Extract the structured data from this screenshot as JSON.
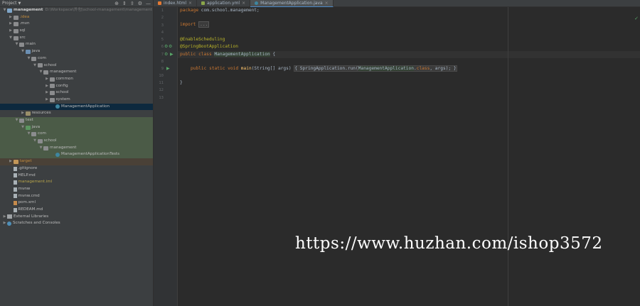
{
  "project_panel": {
    "title": "Project",
    "tree": [
      {
        "label": "management",
        "suffix": "D:\\Workspace\\外包\\school-management\\management",
        "bold": true,
        "depth": 0,
        "arrow": "down",
        "icon": "module"
      },
      {
        "label": ".idea",
        "depth": 1,
        "arrow": "right",
        "icon": "folder",
        "style": "orange"
      },
      {
        "label": ".mvn",
        "depth": 1,
        "arrow": "right",
        "icon": "folder"
      },
      {
        "label": "sql",
        "depth": 1,
        "arrow": "right",
        "icon": "folder"
      },
      {
        "label": "src",
        "depth": 1,
        "arrow": "down",
        "icon": "folder"
      },
      {
        "label": "main",
        "depth": 2,
        "arrow": "down",
        "icon": "folder"
      },
      {
        "label": "java",
        "depth": 3,
        "arrow": "down",
        "icon": "folder-blue"
      },
      {
        "label": "com",
        "depth": 4,
        "arrow": "down",
        "icon": "pkg"
      },
      {
        "label": "school",
        "depth": 5,
        "arrow": "down",
        "icon": "pkg"
      },
      {
        "label": "management",
        "depth": 6,
        "arrow": "down",
        "icon": "pkg"
      },
      {
        "label": "common",
        "depth": 7,
        "arrow": "right",
        "icon": "pkg"
      },
      {
        "label": "config",
        "depth": 7,
        "arrow": "right",
        "icon": "pkg"
      },
      {
        "label": "school",
        "depth": 7,
        "arrow": "right",
        "icon": "pkg"
      },
      {
        "label": "system",
        "depth": 7,
        "arrow": "right",
        "icon": "pkg"
      },
      {
        "label": "ManagementApplication",
        "depth": 8,
        "arrow": "",
        "icon": "class",
        "row": "sel"
      },
      {
        "label": "resources",
        "depth": 3,
        "arrow": "right",
        "icon": "folder-res"
      },
      {
        "label": "test",
        "depth": 2,
        "arrow": "down",
        "icon": "folder",
        "row": "band"
      },
      {
        "label": "java",
        "depth": 3,
        "arrow": "down",
        "icon": "folder-green",
        "row": "band"
      },
      {
        "label": "com",
        "depth": 4,
        "arrow": "down",
        "icon": "pkg",
        "row": "band"
      },
      {
        "label": "school",
        "depth": 5,
        "arrow": "down",
        "icon": "pkg",
        "row": "band"
      },
      {
        "label": "management",
        "depth": 6,
        "arrow": "down",
        "icon": "pkg",
        "row": "band"
      },
      {
        "label": "ManagementApplicationTests",
        "depth": 8,
        "arrow": "",
        "icon": "class",
        "row": "band"
      },
      {
        "label": "target",
        "depth": 1,
        "arrow": "right",
        "icon": "folder-orange",
        "row": "excl",
        "style": "orange"
      },
      {
        "label": ".gitignore",
        "depth": 1,
        "arrow": "",
        "icon": "file"
      },
      {
        "label": "HELP.md",
        "depth": 1,
        "arrow": "",
        "icon": "file"
      },
      {
        "label": "management.iml",
        "depth": 1,
        "arrow": "",
        "icon": "file",
        "style": "yellow"
      },
      {
        "label": "mvnw",
        "depth": 1,
        "arrow": "",
        "icon": "file"
      },
      {
        "label": "mvnw.cmd",
        "depth": 1,
        "arrow": "",
        "icon": "file"
      },
      {
        "label": "pom.xml",
        "depth": 1,
        "arrow": "",
        "icon": "xml"
      },
      {
        "label": "REDEAM.md",
        "depth": 1,
        "arrow": "",
        "icon": "file"
      },
      {
        "label": "External Libraries",
        "depth": 0,
        "arrow": "right",
        "icon": "lib"
      },
      {
        "label": "Scratches and Consoles",
        "depth": 0,
        "arrow": "right",
        "icon": "scratch"
      }
    ]
  },
  "tabs": [
    {
      "label": "index.html",
      "icon_color": "#e37933",
      "active": false
    },
    {
      "label": "application.yml",
      "icon_color": "#8aa64a",
      "active": false
    },
    {
      "label": "ManagementApplication.java",
      "icon_color": "#3e86a0",
      "active": true
    }
  ],
  "code": {
    "line_numbers": [
      "1",
      "2",
      "3",
      "4",
      "5",
      "6",
      "7",
      "8",
      "9",
      "10",
      "11",
      "12",
      "13",
      "14",
      "15",
      "16"
    ],
    "lines": {
      "l1_kw": "package",
      "l1_rest": " com.school.management;",
      "l3_kw": "import",
      "l3_fold": "...",
      "l6": "@EnableScheduling",
      "l7": "@SpringBootApplication",
      "l8_kw": "public class",
      "l8_name": "ManagementApplication",
      "l8_rest": " {",
      "l10_kw": "public static void",
      "l10_fn": "main",
      "l10_args": "(String[] args)",
      "l10_body_a": " SpringApplication.run(",
      "l10_body_hl": "ManagementApplication",
      "l10_body_b": ".",
      "l10_class": "class",
      "l10_body_c": ", args); ",
      "l14": "}"
    }
  },
  "watermark": "https://www.huzhan.com/ishop3572"
}
